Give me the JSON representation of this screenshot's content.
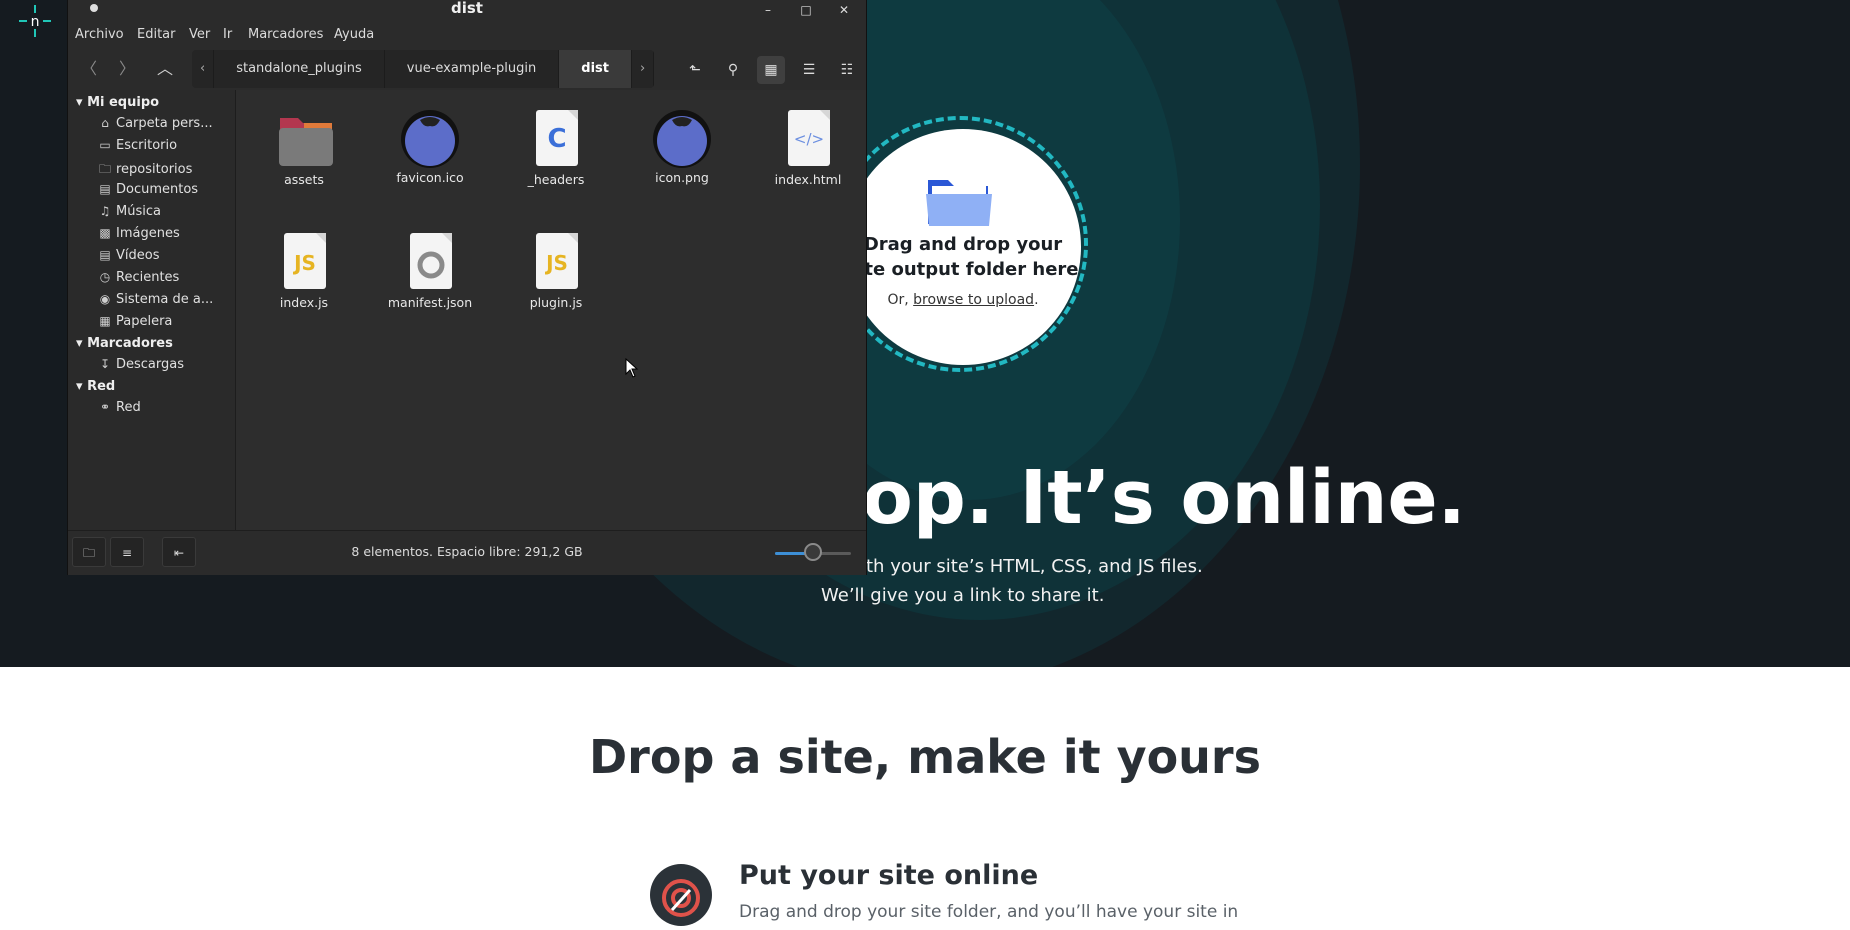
{
  "page": {
    "hero_headline_visible": "op. It’s online.",
    "hero_line1_visible": "th your site’s HTML, CSS, and JS files.",
    "hero_line2": "We’ll give you a link to share it.",
    "drop_title": "Drag and drop your site output folder here",
    "drop_or": "Or,",
    "drop_link": "browse to upload",
    "drop_period": ".",
    "section_title": "Drop a site, make it yours",
    "feature_title": "Put your site online",
    "feature_text_visible": "Drag and drop your site folder, and you’ll have your site in"
  },
  "window": {
    "title": "dist",
    "menu": [
      "Archivo",
      "Editar",
      "Ver",
      "Ir",
      "Marcadores",
      "Ayuda"
    ],
    "breadcrumbs": [
      "standalone_plugins",
      "vue-example-plugin",
      "dist"
    ],
    "sidebar": {
      "sections": [
        {
          "label": "Mi equipo",
          "items": [
            "Carpeta pers...",
            "Escritorio",
            "repositorios",
            "Documentos",
            "Música",
            "Imágenes",
            "Vídeos",
            "Recientes",
            "Sistema de a...",
            "Papelera"
          ]
        },
        {
          "label": "Marcadores",
          "items": [
            "Descargas"
          ]
        },
        {
          "label": "Red",
          "items": [
            "Red"
          ]
        }
      ]
    },
    "files": [
      "assets",
      "favicon.ico",
      "_headers",
      "icon.png",
      "index.html",
      "index.js",
      "manifest.json",
      "plugin.js"
    ],
    "file_icon_letters": {
      "headers": "C",
      "js": "JS",
      "html": "</>"
    },
    "status": "8 elementos. Espacio libre: 291,2 GB",
    "zoom_fraction": 0.5
  },
  "colors": {
    "hero_bg": "#151b20",
    "ring": "#0f3a40",
    "dash": "#22b8c2",
    "brand_teal": "#20c6b7"
  },
  "icons": {
    "logo": "netlify-logo",
    "folder": "folder-icon",
    "feature": "target-icon"
  }
}
